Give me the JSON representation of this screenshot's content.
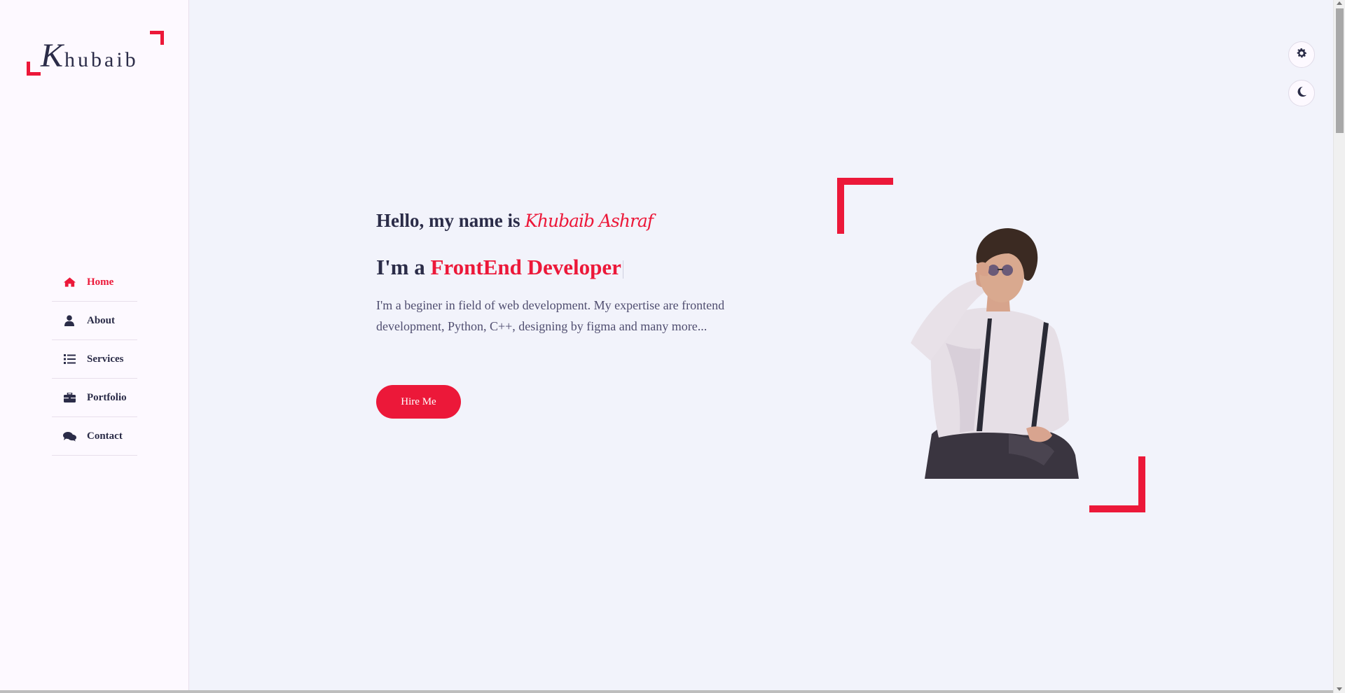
{
  "brand": {
    "logo_text": "Khubaib",
    "accent_color": "#ec1839",
    "text_color": "#2b2c48"
  },
  "sidebar": {
    "items": [
      {
        "label": "Home",
        "icon": "home-icon",
        "active": true
      },
      {
        "label": "About",
        "icon": "user-icon",
        "active": false
      },
      {
        "label": "Services",
        "icon": "list-icon",
        "active": false
      },
      {
        "label": "Portfolio",
        "icon": "briefcase-icon",
        "active": false
      },
      {
        "label": "Contact",
        "icon": "comments-icon",
        "active": false
      }
    ]
  },
  "hero": {
    "greeting": "Hello, my name is",
    "name": "Khubaib Ashraf",
    "role_prefix": "I'm a",
    "role": "FrontEnd Developer",
    "description": "I'm a beginer in field of web development. My expertise are frontend development, Python, C++, designing by figma and many more...",
    "cta_label": "Hire Me"
  },
  "controls": {
    "settings_icon": "gear-icon",
    "theme_icon": "moon-icon"
  }
}
